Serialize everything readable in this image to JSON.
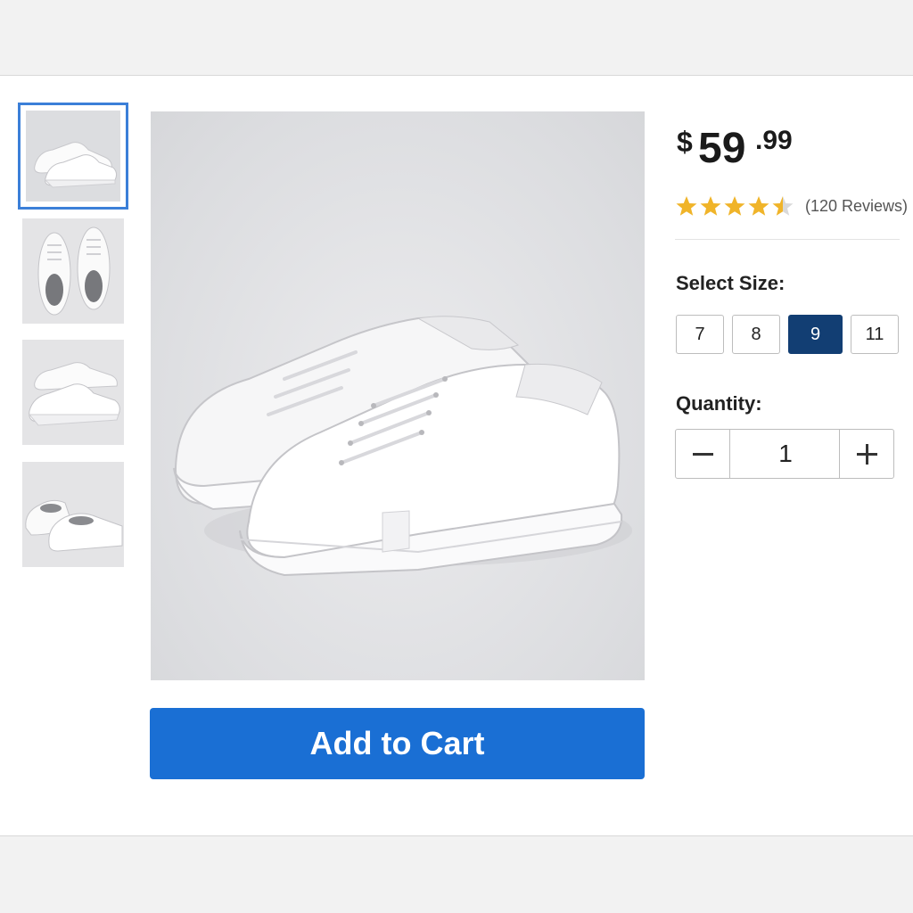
{
  "product": {
    "thumbnails": [
      {
        "view": "pair-side-angle",
        "selected": true
      },
      {
        "view": "pair-top-down",
        "selected": false
      },
      {
        "view": "pair-side-profile",
        "selected": false
      },
      {
        "view": "pair-back-angle",
        "selected": false
      }
    ],
    "main_image": {
      "subject": "white-low-top-sneakers"
    }
  },
  "price": {
    "currency": "$",
    "whole": "59",
    "cents": ".99"
  },
  "rating": {
    "stars": 4.5,
    "max": 5,
    "reviews_label": "(120 Reviews)",
    "star_color": "#f0b429"
  },
  "size": {
    "label": "Select Size:",
    "options": [
      "7",
      "8",
      "9",
      "11"
    ],
    "selected": "9"
  },
  "quantity": {
    "label": "Quantity:",
    "value": "1",
    "decrement_icon": "minus-icon",
    "increment_icon": "plus-icon"
  },
  "cart": {
    "button_label": "Add to Cart",
    "button_color": "#1a6fd4"
  }
}
